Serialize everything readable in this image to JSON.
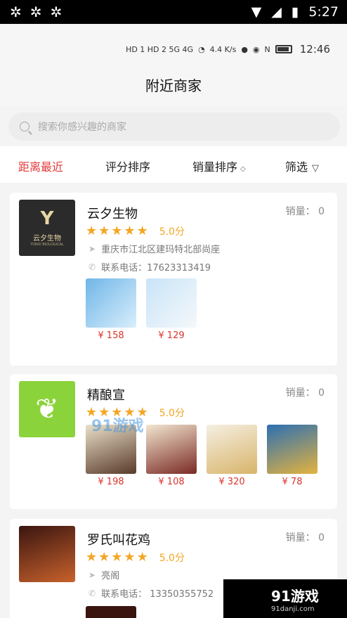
{
  "system_status": {
    "time": "5:27"
  },
  "inner_status": {
    "network": "HD 1 HD 2 5G 4G",
    "speed": "4.4 K/s",
    "time": "12:46"
  },
  "header": {
    "title": "附近商家"
  },
  "search": {
    "placeholder": "搜索你感兴趣的商家"
  },
  "sort": {
    "tabs": [
      {
        "label": "距离最近",
        "active": true
      },
      {
        "label": "评分排序",
        "active": false
      },
      {
        "label": "销量排序",
        "active": false
      },
      {
        "label": "筛选",
        "active": false
      }
    ]
  },
  "shops": [
    {
      "name": "云夕生物",
      "logo_text": "云夕生物",
      "logo_sub": "YUNXI BIOLOGICAL",
      "sales": "销量：  0",
      "rating": "5.0分",
      "address": "重庆市江北区建玛特北部尚座",
      "phone": "联系电话：17623313419",
      "products": [
        {
          "price": "¥ 158"
        },
        {
          "price": "¥ 129"
        }
      ]
    },
    {
      "name": "精酿宣",
      "logo_text": "",
      "sales": "销量：  0",
      "rating": "5.0分",
      "products": [
        {
          "price": "¥ 198"
        },
        {
          "price": "¥ 108"
        },
        {
          "price": "¥ 320"
        },
        {
          "price": "¥ 78"
        }
      ]
    },
    {
      "name": "罗氏叫花鸡",
      "logo_text": "",
      "sales": "销量：  0",
      "rating": "5.0分",
      "address": "亮阁",
      "phone": "联系电话：  13350355752"
    }
  ],
  "watermark": {
    "mid": "91游戏",
    "br_big": "91游戏",
    "br_small": "91danji.com"
  },
  "colors": {
    "accent_red": "#e23a3a",
    "star": "#f4a623",
    "price": "#d9342b"
  }
}
